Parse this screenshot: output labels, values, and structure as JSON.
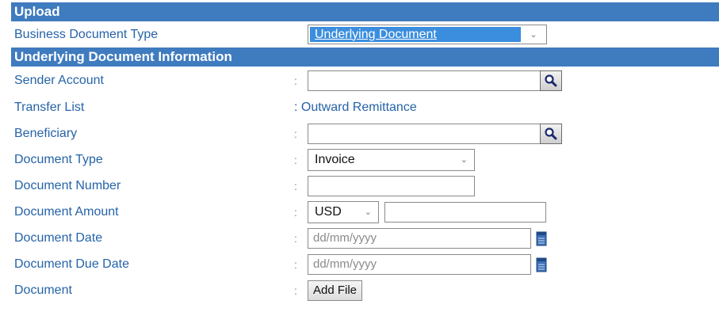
{
  "upload_section": {
    "title": "Upload",
    "business_document_type": {
      "label": "Business Document Type",
      "value": "Underlying Document"
    }
  },
  "underlying_section": {
    "title": "Underlying Document Information",
    "colon": ":",
    "sender_account": {
      "label": "Sender Account",
      "value": ""
    },
    "transfer_list": {
      "label": "Transfer List",
      "value": ": Outward Remittance"
    },
    "beneficiary": {
      "label": "Beneficiary",
      "value": ""
    },
    "document_type": {
      "label": "Document Type",
      "value": "Invoice"
    },
    "document_number": {
      "label": "Document Number",
      "value": ""
    },
    "document_amount": {
      "label": "Document Amount",
      "currency": "USD",
      "value": ""
    },
    "document_date": {
      "label": "Document Date",
      "placeholder": "dd/mm/yyyy"
    },
    "document_due_date": {
      "label": "Document Due Date",
      "placeholder": "dd/mm/yyyy"
    },
    "document": {
      "label": "Document",
      "button_label": "Add File"
    }
  },
  "icons": {
    "search": "magnifier-icon",
    "calendar": "calendar-icon",
    "dropdown": "chevron-down-icon"
  },
  "colors": {
    "header_bg": "#3f7bbf",
    "label_text": "#2563a8",
    "selected_bg": "#3b8ede"
  }
}
